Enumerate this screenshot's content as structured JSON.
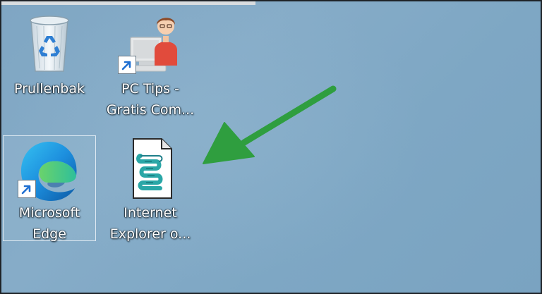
{
  "desktop": {
    "background_color": "#82a9c6",
    "icons": [
      {
        "name": "recycle-bin",
        "lines": [
          "Prullenbak"
        ],
        "shortcut": false,
        "selected": false
      },
      {
        "name": "pc-tips",
        "lines": [
          "PC Tips -",
          "Gratis Com..."
        ],
        "shortcut": true,
        "selected": false
      },
      {
        "name": "microsoft-edge",
        "lines": [
          "Microsoft",
          "Edge"
        ],
        "shortcut": true,
        "selected": true
      },
      {
        "name": "internet-explorer-script",
        "lines": [
          "Internet",
          "Explorer o..."
        ],
        "shortcut": false,
        "selected": false
      }
    ]
  },
  "annotation": {
    "arrow_color": "#2f9e3f",
    "arrow_icon": "green-arrow-icon"
  }
}
